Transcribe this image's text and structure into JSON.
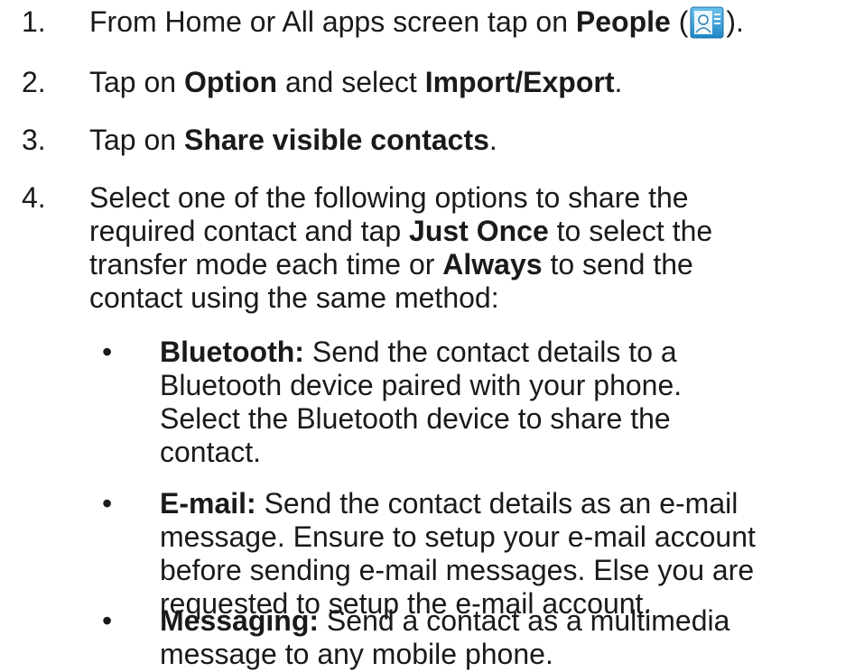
{
  "steps": [
    {
      "number": "1.",
      "lines": [
        {
          "pre": "From Home or All apps screen tap on ",
          "bold": "People",
          "mid": " (",
          "post": ")."
        }
      ]
    },
    {
      "number": "2.",
      "pre": "Tap on ",
      "bold1": "Option",
      "mid": " and select ",
      "bold2": "Import/Export",
      "post": "."
    },
    {
      "number": "3.",
      "pre": "Tap on ",
      "bold": "Share visible contacts",
      "post": "."
    },
    {
      "number": "4.",
      "line1": "Select one of the following options to share the",
      "line2_pre": "required contact and tap ",
      "line2_bold": "Just Once",
      "line2_post": " to select the",
      "line3_pre": "transfer mode each time or ",
      "line3_bold": "Always",
      "line3_post": " to send the",
      "line4": "contact using the same method:"
    }
  ],
  "bullets": [
    {
      "symbol": "•",
      "label": "Bluetooth:",
      "line1_post": " Send the contact details to a",
      "line2": "Bluetooth device paired with your phone.",
      "line3": "Select the Bluetooth device to share the",
      "line4": "contact."
    },
    {
      "symbol": "•",
      "label": "E-mail:",
      "line1_post": " Send the contact details as an e-mail",
      "line2": "message. Ensure to setup your e-mail account",
      "line3": "before sending e-mail messages. Else you are",
      "line4": "requested to setup the e-mail account."
    },
    {
      "symbol": "•",
      "label": "Messaging:",
      "line1_post": " Send a contact as a multimedia",
      "line2": "message to any mobile phone."
    }
  ],
  "icons": {
    "people": "people-app-icon"
  },
  "colors": {
    "text": "#1a1a1a",
    "icon_blue": "#3aa0d8"
  }
}
